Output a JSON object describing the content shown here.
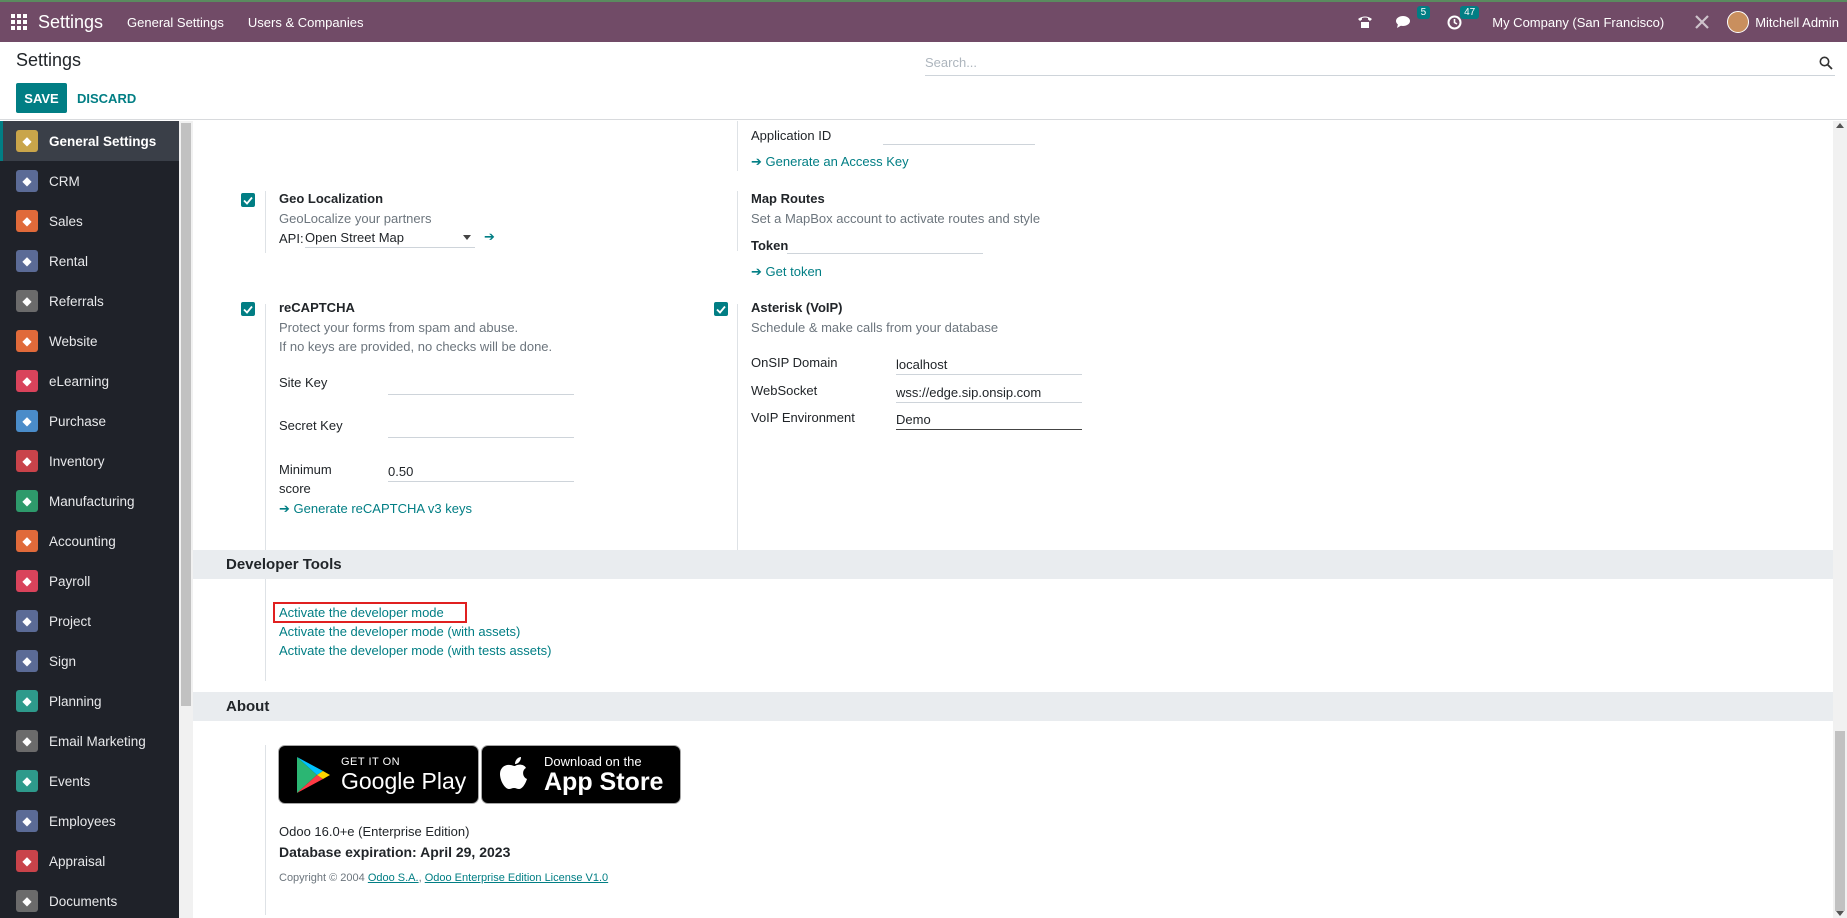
{
  "navbar": {
    "brand": "Settings",
    "menu": [
      "General Settings",
      "Users & Companies"
    ],
    "messages_count": "5",
    "activities_count": "47",
    "company": "My Company (San Francisco)",
    "user": "Mitchell Admin"
  },
  "control_panel": {
    "title": "Settings",
    "search_placeholder": "Search...",
    "save_label": "SAVE",
    "discard_label": "DISCARD"
  },
  "sidebar": {
    "items": [
      {
        "label": "General Settings",
        "icon": "gear-icon",
        "color": "#c9a54a"
      },
      {
        "label": "CRM",
        "icon": "crm-icon",
        "color": "#5b6b96"
      },
      {
        "label": "Sales",
        "icon": "sales-icon",
        "color": "#e06a3a"
      },
      {
        "label": "Rental",
        "icon": "rental-icon",
        "color": "#5b6b96"
      },
      {
        "label": "Referrals",
        "icon": "referrals-icon",
        "color": "#6b6b6b"
      },
      {
        "label": "Website",
        "icon": "website-icon",
        "color": "#e06a3a"
      },
      {
        "label": "eLearning",
        "icon": "elearning-icon",
        "color": "#d9435b"
      },
      {
        "label": "Purchase",
        "icon": "purchase-icon",
        "color": "#4a8cc9"
      },
      {
        "label": "Inventory",
        "icon": "inventory-icon",
        "color": "#c9434a"
      },
      {
        "label": "Manufacturing",
        "icon": "manufacturing-icon",
        "color": "#2e9a6b"
      },
      {
        "label": "Accounting",
        "icon": "accounting-icon",
        "color": "#e06a3a"
      },
      {
        "label": "Payroll",
        "icon": "payroll-icon",
        "color": "#d9435b"
      },
      {
        "label": "Project",
        "icon": "project-icon",
        "color": "#5b6b96"
      },
      {
        "label": "Sign",
        "icon": "sign-icon",
        "color": "#5b6b96"
      },
      {
        "label": "Planning",
        "icon": "planning-icon",
        "color": "#2e9a8b"
      },
      {
        "label": "Email Marketing",
        "icon": "email-marketing-icon",
        "color": "#6b6b6b"
      },
      {
        "label": "Events",
        "icon": "events-icon",
        "color": "#2e9a8b"
      },
      {
        "label": "Employees",
        "icon": "employees-icon",
        "color": "#5b6b96"
      },
      {
        "label": "Appraisal",
        "icon": "appraisal-icon",
        "color": "#c9434a"
      },
      {
        "label": "Documents",
        "icon": "documents-icon",
        "color": "#6b6b6b"
      }
    ]
  },
  "integrations": {
    "application_id_label": "Application ID",
    "generate_access_key": "Generate an Access Key",
    "geo": {
      "title": "Geo Localization",
      "desc": "GeoLocalize your partners",
      "api_label": "API:",
      "api_value": "Open Street Map"
    },
    "map_routes": {
      "title": "Map Routes",
      "desc": "Set a MapBox account to activate routes and style",
      "token_label": "Token",
      "get_token": "Get token"
    },
    "recaptcha": {
      "title": "reCAPTCHA",
      "desc1": "Protect your forms from spam and abuse.",
      "desc2": "If no keys are provided, no checks will be done.",
      "site_key_label": "Site Key",
      "secret_key_label": "Secret Key",
      "min_score_label_1": "Minimum",
      "min_score_label_2": "score",
      "min_score_value": "0.50",
      "generate_keys": "Generate reCAPTCHA v3 keys"
    },
    "voip": {
      "title": "Asterisk (VoIP)",
      "desc": "Schedule & make calls from your database",
      "onsip_label": "OnSIP Domain",
      "onsip_value": "localhost",
      "websocket_label": "WebSocket",
      "websocket_value": "wss://edge.sip.onsip.com",
      "env_label": "VoIP Environment",
      "env_value": "Demo"
    }
  },
  "developer_tools": {
    "title": "Developer Tools",
    "links": [
      "Activate the developer mode",
      "Activate the developer mode (with assets)",
      "Activate the developer mode (with tests assets)"
    ]
  },
  "about": {
    "title": "About",
    "google_play_top": "GET IT ON",
    "google_play_bottom": "Google Play",
    "app_store_top": "Download on the",
    "app_store_bottom": "App Store",
    "version": "Odoo 16.0+e (Enterprise Edition)",
    "expiration": "Database expiration: April 29, 2023",
    "copyright": "Copyright © 2004",
    "odoo_sa": "Odoo S.A.",
    "license": "Odoo Enterprise Edition License V1.0"
  }
}
